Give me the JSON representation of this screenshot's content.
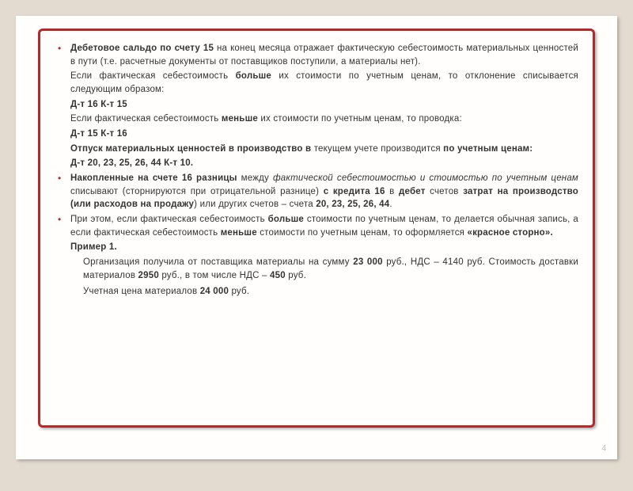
{
  "pageNumber": "4",
  "p1_a": "Дебетовое сальдо по счету 15",
  "p1_b": " на конец месяца отражает фактическую себестоимость материальных ценностей в пути (т.е. расчетные документы от поставщиков поступили, а материалы нет).",
  "p2_a": "Если фактическая себестоимость ",
  "p2_b": "больше",
  "p2_c": " их стоимости по учетным ценам, то отклонение списывается следующим образом:",
  "p3": "Д-т 16 К-т 15",
  "p4_a": "Если фактическая себестоимость ",
  "p4_b": "меньше",
  "p4_c": " их стоимости по учетным ценам, то проводка:",
  "p5": "Д-т 15 К-т 16",
  "p6_a": "Отпуск материальных ценностей в производство в",
  "p6_b": " текущем учете производится ",
  "p6_c": "по учетным ценам:",
  "p7": "Д-т 20, 23, 25, 26, 44 К-т 10.",
  "p8_a": "Накопленные на счете 16 разницы",
  "p8_b": " между ",
  "p8_c": "фактической себестоимостью и стоимостью по учетным ценам",
  "p8_d": " списывают (сторнируются при отрицательной разнице) ",
  "p8_e": "с кредита 16",
  "p8_f": " в ",
  "p8_g": "дебет",
  "p8_h": " счетов ",
  "p8_i": "затрат на производство (или расходов на продажу",
  "p8_j": ") или других счетов – счета ",
  "p8_k": "20, 23, 25, 26, 44",
  "p8_l": ".",
  "p9_a": "При этом, если фактическая себестоимость ",
  "p9_b": "больше",
  "p9_c": " стоимости по учетным ценам, то делается обычная запись, а если фактическая себестоимость ",
  "p9_d": "меньше",
  "p9_e": " стоимости по учетным ценам, то оформляется ",
  "p9_f": "«красное сторно».",
  "p10": "Пример 1.",
  "p11_a": "Организация получила от поставщика материалы на сумму ",
  "p11_b": "23 000",
  "p11_c": " руб., НДС – 4140 руб. Стоимость доставки материалов ",
  "p11_d": "2950",
  "p11_e": " руб., в том числе НДС – ",
  "p11_f": "450",
  "p11_g": " руб.",
  "p12_a": "Учетная цена материалов ",
  "p12_b": "24 000",
  "p12_c": " руб."
}
